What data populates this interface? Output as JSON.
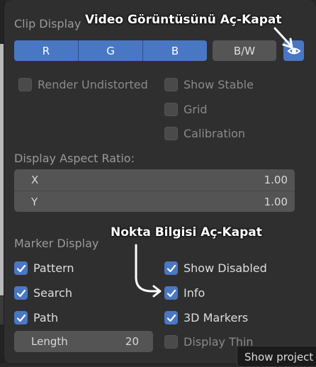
{
  "clip_display": {
    "title": "Clip Display",
    "channels": [
      "R",
      "G",
      "B"
    ],
    "bw_label": "B/W",
    "eye_icon": "eye-icon"
  },
  "checkboxes_top": {
    "render_undistorted": {
      "label": "Render Undistorted",
      "checked": false
    },
    "show_stable": {
      "label": "Show Stable",
      "checked": false
    },
    "grid": {
      "label": "Grid",
      "checked": false
    },
    "calibration": {
      "label": "Calibration",
      "checked": false
    }
  },
  "aspect_ratio": {
    "label": "Display Aspect Ratio:",
    "x_label": "X",
    "x_value": "1.00",
    "y_label": "Y",
    "y_value": "1.00"
  },
  "marker_display": {
    "title": "Marker Display",
    "pattern": {
      "label": "Pattern",
      "checked": true
    },
    "search": {
      "label": "Search",
      "checked": true
    },
    "path": {
      "label": "Path",
      "checked": true
    },
    "show_disabled": {
      "label": "Show Disabled",
      "checked": true
    },
    "info": {
      "label": "Info",
      "checked": true
    },
    "markers_3d": {
      "label": "3D Markers",
      "checked": true
    },
    "display_thin": {
      "label": "Display Thin",
      "checked": false
    },
    "length_label": "Length",
    "length_value": "20"
  },
  "tooltip": {
    "text": "Show project"
  },
  "annotations": {
    "video_toggle": "Video Görüntüsünü Aç-Kapat",
    "info_toggle": "Nokta Bilgisi Aç-Kapat"
  },
  "colors": {
    "accent": "#4a77c4",
    "panel_bg": "#2f2f2f",
    "field_bg": "#545454",
    "annotation_text": "#ffffff"
  }
}
